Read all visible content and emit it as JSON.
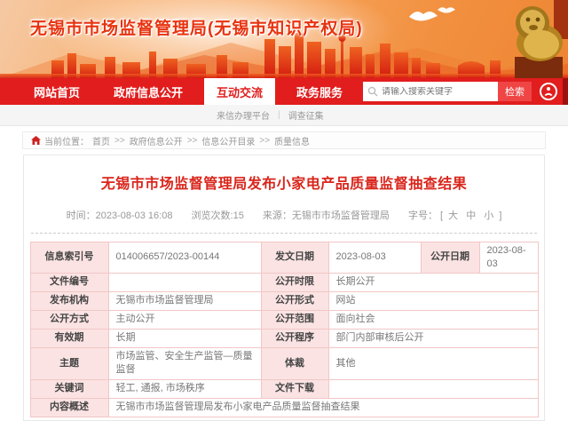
{
  "banner": {
    "title": "无锡市市场监督管理局(无锡市知识产权局)"
  },
  "nav": {
    "items": [
      {
        "label": "网站首页"
      },
      {
        "label": "政府信息公开"
      },
      {
        "label": "互动交流"
      },
      {
        "label": "政务服务"
      }
    ],
    "search": {
      "placeholder": "请输入搜索关键字",
      "button_label": "检索"
    }
  },
  "subnav": {
    "items": [
      "来信办理平台",
      "调查征集"
    ],
    "separator": "|"
  },
  "breadcrumb": {
    "prefix": "当前位置：",
    "separator": ">>",
    "items": [
      "首页",
      "政府信息公开",
      "信息公开目录",
      "质量信息"
    ]
  },
  "article": {
    "title": "无锡市市场监督管理局发布小家电产品质量监督抽查结果",
    "meta": {
      "time_label": "时间：",
      "time": "2023-08-03 16:08",
      "views_label": "浏览次数:",
      "views": "15",
      "source_label": "来源：",
      "source": "无锡市市场监督管理局",
      "fontsize_label": "字号：",
      "bracket_open": "[",
      "bracket_close": "]",
      "sizes": [
        "大",
        "中",
        "小"
      ]
    }
  },
  "info_table": {
    "r1": {
      "l1": "信息索引号",
      "v1": "014006657/2023-00144",
      "l2": "发文日期",
      "v2": "2023-08-03",
      "l3": "公开日期",
      "v3": "2023-08-03"
    },
    "r2": {
      "l1": "文件编号",
      "v1": "",
      "l2": "公开时限",
      "v2": "长期公开"
    },
    "r3": {
      "l1": "发布机构",
      "v1": "无锡市市场监督管理局",
      "l2": "公开形式",
      "v2": "网站"
    },
    "r4": {
      "l1": "公开方式",
      "v1": "主动公开",
      "l2": "公开范围",
      "v2": "面向社会"
    },
    "r5": {
      "l1": "有效期",
      "v1": "长期",
      "l2": "公开程序",
      "v2": "部门内部审核后公开"
    },
    "r6": {
      "l1": "主题",
      "v1": "市场监管、安全生产监管—质量监督",
      "l2": "体裁",
      "v2": "其他"
    },
    "r7": {
      "l1": "关键词",
      "v1": "轻工, 通报, 市场秩序",
      "l2": "文件下载",
      "v2": ""
    },
    "r8": {
      "l1": "内容概述",
      "v1": "无锡市市场监督管理局发布小家电产品质量监督抽查结果"
    }
  },
  "icons": {
    "home": "house",
    "search": "magnifier",
    "accessibility": "person-in-circle",
    "dove": "bird",
    "lion": "stone-lion-statue",
    "skyline": "city-silhouette"
  },
  "colors": {
    "nav_red": "#e11d1d",
    "banner_title_red": "#e8330f",
    "article_title_red": "#d9261c",
    "table_border": "#f2c6c6",
    "table_label_bg": "#fbe3e3",
    "skyline_red_top": "#ef6220",
    "skyline_red_bottom": "#d31b10",
    "lion_gold": "#c9992f"
  }
}
